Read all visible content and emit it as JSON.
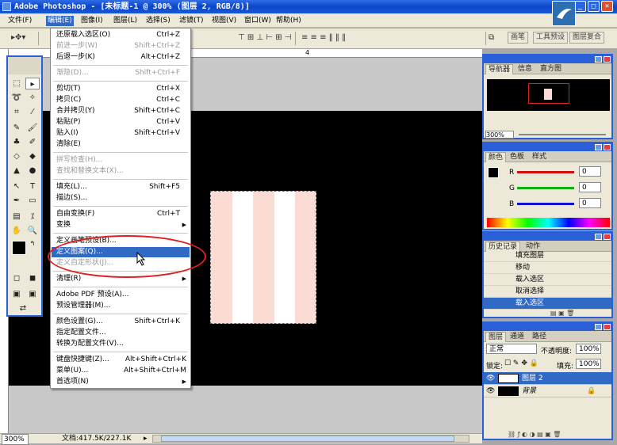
{
  "window": {
    "title": "Adobe Photoshop - [未标题-1 @ 300% (图层 2, RGB/8)]"
  },
  "menubar": {
    "items": [
      "文件(F)",
      "编辑(E)",
      "图像(I)",
      "图层(L)",
      "选择(S)",
      "滤镜(T)",
      "视图(V)",
      "窗口(W)",
      "帮助(H)"
    ]
  },
  "optionsbar": {
    "dock_tabs": [
      "画笔",
      "工具预设",
      "图层复合"
    ],
    "ruler_mark": "4"
  },
  "edit_menu": {
    "items": [
      {
        "label": "还原载入选区(O)",
        "shortcut": "Ctrl+Z",
        "disabled": false
      },
      {
        "label": "前进一步(W)",
        "shortcut": "Shift+Ctrl+Z",
        "disabled": true
      },
      {
        "label": "后退一步(K)",
        "shortcut": "Alt+Ctrl+Z",
        "disabled": false
      },
      {
        "label": "渐隐(D)...",
        "shortcut": "Shift+Ctrl+F",
        "disabled": true
      },
      {
        "label": "剪切(T)",
        "shortcut": "Ctrl+X",
        "disabled": false
      },
      {
        "label": "拷贝(C)",
        "shortcut": "Ctrl+C",
        "disabled": false
      },
      {
        "label": "合并拷贝(Y)",
        "shortcut": "Shift+Ctrl+C",
        "disabled": false
      },
      {
        "label": "粘贴(P)",
        "shortcut": "Ctrl+V",
        "disabled": false
      },
      {
        "label": "贴入(I)",
        "shortcut": "Shift+Ctrl+V",
        "disabled": false
      },
      {
        "label": "清除(E)",
        "shortcut": "",
        "disabled": false
      },
      {
        "label": "拼写检查(H)...",
        "shortcut": "",
        "disabled": true
      },
      {
        "label": "查找和替换文本(X)...",
        "shortcut": "",
        "disabled": true
      },
      {
        "label": "填充(L)...",
        "shortcut": "Shift+F5",
        "disabled": false
      },
      {
        "label": "描边(S)...",
        "shortcut": "",
        "disabled": false
      },
      {
        "label": "自由变换(F)",
        "shortcut": "Ctrl+T",
        "disabled": false
      },
      {
        "label": "变换",
        "shortcut": "",
        "disabled": false
      },
      {
        "label": "定义画笔预设(B)...",
        "shortcut": "",
        "disabled": false
      },
      {
        "label": "定义图案(Q)...",
        "shortcut": "",
        "disabled": false
      },
      {
        "label": "定义自定形状(J)...",
        "shortcut": "",
        "disabled": true
      },
      {
        "label": "清理(R)",
        "shortcut": "",
        "disabled": false
      },
      {
        "label": "Adobe PDF 预设(A)...",
        "shortcut": "",
        "disabled": false
      },
      {
        "label": "预设管理器(M)...",
        "shortcut": "",
        "disabled": false
      },
      {
        "label": "颜色设置(G)...",
        "shortcut": "Shift+Ctrl+K",
        "disabled": false
      },
      {
        "label": "指定配置文件...",
        "shortcut": "",
        "disabled": false
      },
      {
        "label": "转换为配置文件(V)...",
        "shortcut": "",
        "disabled": false
      },
      {
        "label": "键盘快捷键(Z)...",
        "shortcut": "Alt+Shift+Ctrl+K",
        "disabled": false
      },
      {
        "label": "菜单(U)...",
        "shortcut": "Alt+Shift+Ctrl+M",
        "disabled": false
      },
      {
        "label": "首选项(N)",
        "shortcut": "",
        "disabled": false
      }
    ]
  },
  "status": {
    "zoom": "300%",
    "doc_info": "文档:417.5K/227.1K"
  },
  "navigator": {
    "tabs": [
      "导航器",
      "信息",
      "直方图"
    ],
    "zoom": "300%"
  },
  "color_panel": {
    "tabs": [
      "颜色",
      "色板",
      "样式"
    ],
    "channels": [
      {
        "label": "R",
        "value": "0",
        "color": "#d01010"
      },
      {
        "label": "G",
        "value": "0",
        "color": "#10b010"
      },
      {
        "label": "B",
        "value": "0",
        "color": "#1010d0"
      }
    ]
  },
  "history": {
    "tabs": [
      "历史记录",
      "动作"
    ],
    "items": [
      "填充图层",
      "移动",
      "载入选区",
      "取消选择",
      "载入选区"
    ]
  },
  "layers": {
    "tabs": [
      "图层",
      "通道",
      "路径"
    ],
    "blend_mode": "正常",
    "opacity_label": "不透明度:",
    "opacity": "100%",
    "lock_label": "锁定:",
    "fill_label": "填充:",
    "fill": "100%",
    "items": [
      "图层 2",
      "背景"
    ]
  }
}
